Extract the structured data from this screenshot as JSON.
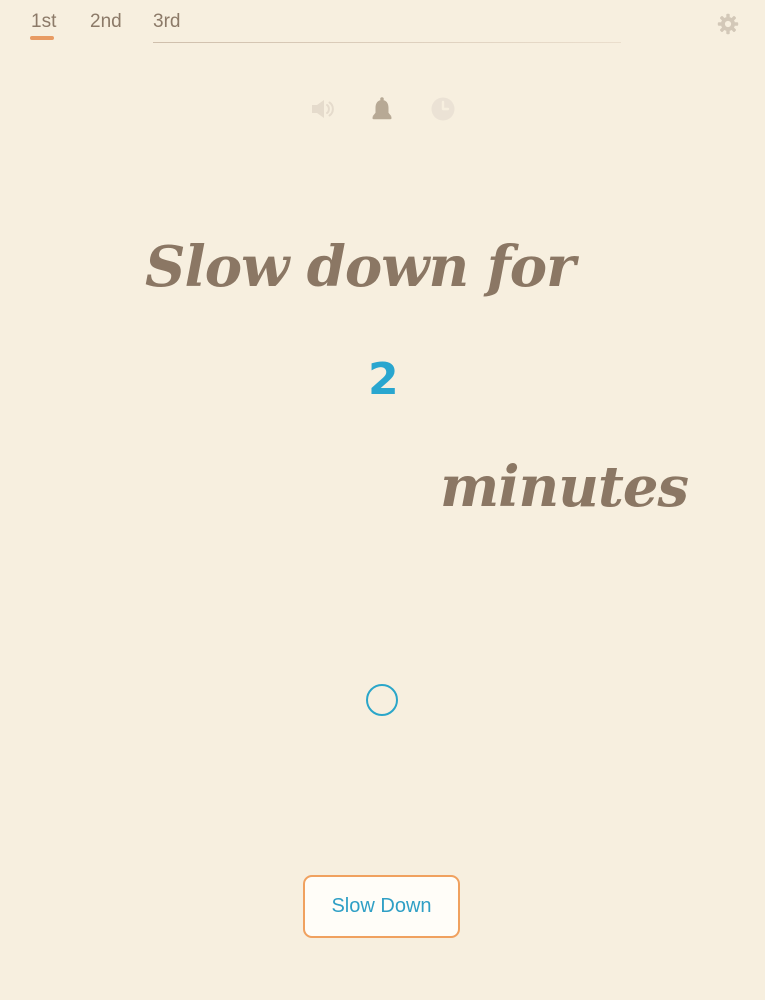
{
  "tabs": [
    {
      "label": "1st",
      "active": true
    },
    {
      "label": "2nd",
      "active": false
    },
    {
      "label": "3rd",
      "active": false
    }
  ],
  "toolbar": {
    "settings_icon": "gear-icon",
    "icons": [
      "speaker-icon",
      "bell-icon",
      "clock-icon"
    ]
  },
  "main": {
    "headline": "Slow down for",
    "minutes_value": "2",
    "minutes_label": "minutes"
  },
  "progress": {
    "indicator_icon": "circle-progress-icon"
  },
  "button": {
    "label": "Slow Down"
  },
  "colors": {
    "background": "#f7efdf",
    "accent_orange": "#e89b63",
    "accent_blue": "#29a6cf",
    "text_brown": "#8b7764"
  }
}
